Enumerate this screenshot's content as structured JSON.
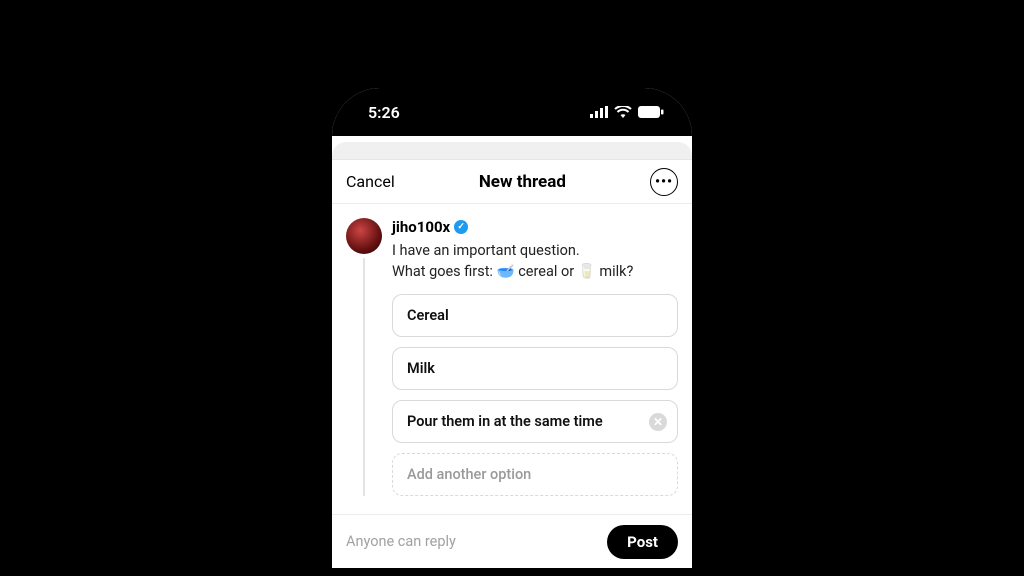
{
  "statusbar": {
    "time": "5:26"
  },
  "navbar": {
    "cancel": "Cancel",
    "title": "New thread"
  },
  "compose": {
    "username": "jiho100x",
    "text_line1": "I have an important question.",
    "text_line2_pre": "What goes first: ",
    "text_line2_mid": " cereal or ",
    "text_line2_post": " milk?",
    "emoji_cereal": "🥣",
    "emoji_milk": "🥛"
  },
  "poll": {
    "options": {
      "0": "Cereal",
      "1": "Milk",
      "2": "Pour them in at the same time"
    },
    "add_placeholder": "Add another option"
  },
  "bottombar": {
    "reply_scope": "Anyone can reply",
    "post": "Post"
  },
  "icons": {
    "verified_check": "✓",
    "more_dots": "•••",
    "remove_x": "✕"
  }
}
